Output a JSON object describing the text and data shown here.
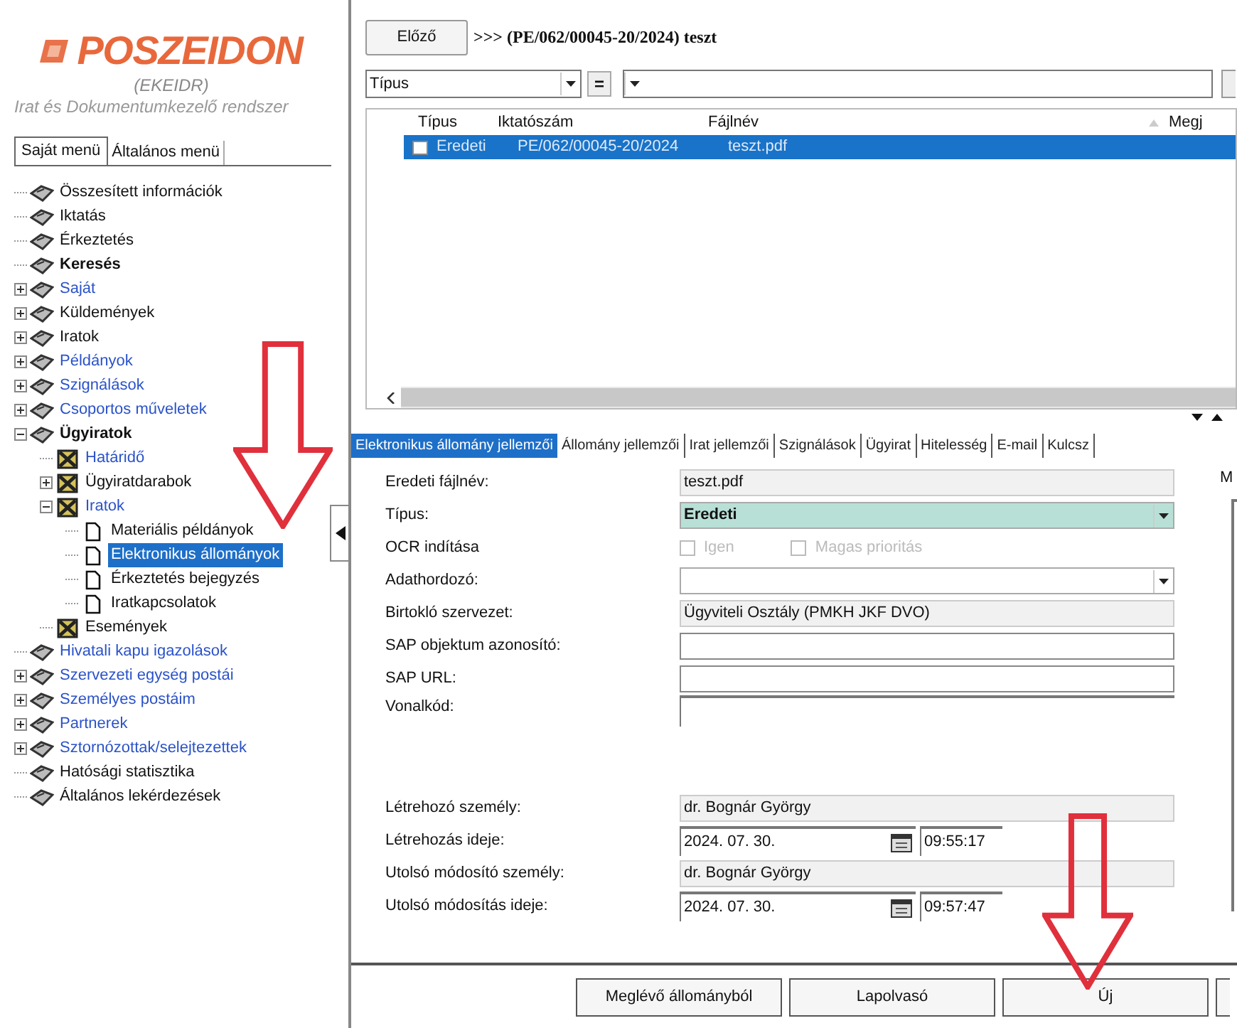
{
  "logo": {
    "title": "POSZEIDON",
    "subtitle": "(EKEIDR)",
    "tagline": "Irat és Dokumentumkezelő rendszer"
  },
  "menu_tabs": [
    {
      "label": "Saját menü",
      "selected": true
    },
    {
      "label": "Általános menü",
      "selected": false
    }
  ],
  "tree": [
    {
      "label": "Összesített információk",
      "kind": "book",
      "color": "#111111",
      "bold": false,
      "selected": false
    },
    {
      "label": "Iktatás",
      "kind": "book",
      "color": "#111111",
      "bold": false,
      "selected": false
    },
    {
      "label": "Érkeztetés",
      "kind": "book",
      "color": "#111111",
      "bold": false,
      "selected": false
    },
    {
      "label": "Keresés",
      "kind": "book",
      "color": "#111111",
      "bold": true,
      "selected": false
    },
    {
      "label": "Saját",
      "kind": "book",
      "color": "#2a52c9",
      "bold": false,
      "expanded": false,
      "selected": false
    },
    {
      "label": "Küldemények",
      "kind": "book",
      "color": "#111111",
      "bold": false,
      "expanded": false,
      "selected": false
    },
    {
      "label": "Iratok",
      "kind": "book",
      "color": "#111111",
      "bold": false,
      "expanded": false,
      "selected": false
    },
    {
      "label": "Példányok",
      "kind": "book",
      "color": "#2a52c9",
      "bold": false,
      "expanded": false,
      "selected": false
    },
    {
      "label": "Szignálások",
      "kind": "book",
      "color": "#2a52c9",
      "bold": false,
      "expanded": false,
      "selected": false
    },
    {
      "label": "Csoportos műveletek",
      "kind": "book",
      "color": "#2a52c9",
      "bold": false,
      "expanded": false,
      "selected": false
    },
    {
      "label": "Ügyiratok",
      "kind": "book",
      "color": "#111111",
      "bold": true,
      "expanded": true,
      "selected": false,
      "children": [
        {
          "label": "Határidő",
          "kind": "case",
          "color": "#2a52c9",
          "bold": false,
          "selected": false
        },
        {
          "label": "Ügyiratdarabok",
          "kind": "case",
          "color": "#111111",
          "bold": false,
          "expanded": false,
          "selected": false
        },
        {
          "label": "Iratok",
          "kind": "case",
          "color": "#2a52c9",
          "bold": false,
          "expanded": true,
          "selected": false,
          "children": [
            {
              "label": "Materiális példányok",
              "kind": "page",
              "color": "#111111",
              "bold": false,
              "selected": false
            },
            {
              "label": "Elektronikus állományok",
              "kind": "page",
              "bold": false,
              "selected": true
            },
            {
              "label": "Érkeztetés bejegyzés",
              "kind": "page",
              "color": "#111111",
              "bold": false,
              "selected": false
            },
            {
              "label": "Iratkapcsolatok",
              "kind": "page",
              "color": "#111111",
              "bold": false,
              "selected": false
            }
          ]
        },
        {
          "label": "Események",
          "kind": "case",
          "color": "#111111",
          "bold": false,
          "selected": false
        }
      ]
    },
    {
      "label": "Hivatali kapu igazolások",
      "kind": "book",
      "color": "#2a52c9",
      "bold": false,
      "selected": false
    },
    {
      "label": "Szervezeti egység postái",
      "kind": "book",
      "color": "#2a52c9",
      "bold": false,
      "expanded": false,
      "selected": false
    },
    {
      "label": "Személyes postáim",
      "kind": "book",
      "color": "#2a52c9",
      "bold": false,
      "expanded": false,
      "selected": false
    },
    {
      "label": "Partnerek",
      "kind": "book",
      "color": "#2a52c9",
      "bold": false,
      "expanded": false,
      "selected": false
    },
    {
      "label": "Sztornózottak/selejtezettek",
      "kind": "book",
      "color": "#2a52c9",
      "bold": false,
      "expanded": false,
      "selected": false
    },
    {
      "label": "Hatósági statisztika",
      "kind": "book",
      "color": "#111111",
      "bold": false,
      "selected": false
    },
    {
      "label": "Általános lekérdezések",
      "kind": "book",
      "color": "#111111",
      "bold": false,
      "selected": false
    }
  ],
  "header": {
    "back_button": "Előző",
    "breadcrumb": ">>> (PE/062/00045-20/2024) teszt"
  },
  "filter": {
    "field": "Típus",
    "operator": "="
  },
  "table": {
    "columns": [
      "Típus",
      "Iktatószám",
      "Fájlnév",
      "Megj"
    ],
    "rows": [
      {
        "selected": true,
        "checked": false,
        "cells": [
          "Eredeti",
          "PE/062/00045-20/2024",
          "teszt.pdf"
        ]
      }
    ]
  },
  "detail_tabs": [
    {
      "label": "Elektronikus állomány jellemzői",
      "selected": true
    },
    {
      "label": "Állomány jellemzői",
      "selected": false
    },
    {
      "label": "Irat jellemzői",
      "selected": false
    },
    {
      "label": "Szignálások",
      "selected": false
    },
    {
      "label": "Ügyirat",
      "selected": false
    },
    {
      "label": "Hitelesség",
      "selected": false
    },
    {
      "label": "E-mail",
      "selected": false
    },
    {
      "label": "Kulcsz",
      "selected": false
    }
  ],
  "form": [
    {
      "kind": "readonly",
      "label": "Eredeti fájlnév:",
      "value": "teszt.pdf"
    },
    {
      "kind": "select",
      "label": "Típus:",
      "value": "Eredeti",
      "highlighted": true
    },
    {
      "kind": "checks",
      "label": "OCR indítása",
      "options": [
        {
          "label": "Igen",
          "checked": false,
          "disabled": true
        },
        {
          "label": "Magas prioritás",
          "checked": false,
          "disabled": true
        }
      ]
    },
    {
      "kind": "select",
      "label": "Adathordozó:",
      "highlighted": false
    },
    {
      "kind": "readonly",
      "label": "Birtokló szervezet:",
      "value": "Ügyviteli Osztály (PMKH JKF DVO)"
    },
    {
      "kind": "text",
      "label": "SAP objektum azonosító:"
    },
    {
      "kind": "text",
      "label": "SAP URL:"
    },
    {
      "kind": "tall",
      "label": "Vonalkód:"
    },
    {
      "kind": "readonly",
      "label": "Létrehozó személy:",
      "value": "dr. Bognár György"
    },
    {
      "kind": "datetime",
      "label": "Létrehozás ideje:",
      "date": "2024. 07. 30.",
      "time": "09:55:17"
    },
    {
      "kind": "readonly",
      "label": "Utolsó módosító személy:",
      "value": "dr. Bognár György"
    },
    {
      "kind": "datetime",
      "label": "Utolsó módosítás ideje:",
      "date": "2024. 07. 30.",
      "time": "09:57:47"
    }
  ],
  "side_panel": {
    "label": "M"
  },
  "buttons": [
    "Meglévő állományból",
    "Lapolvasó",
    "Új"
  ]
}
